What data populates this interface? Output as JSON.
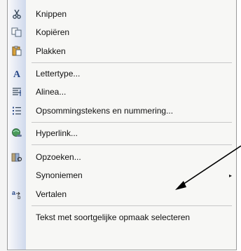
{
  "menu": {
    "items": [
      {
        "label": "Knippen",
        "icon": "scissors-icon"
      },
      {
        "label": "Kopiëren",
        "icon": "copy-icon"
      },
      {
        "label": "Plakken",
        "icon": "paste-icon"
      },
      {
        "label": "Lettertype...",
        "icon": "font-icon"
      },
      {
        "label": "Alinea...",
        "icon": "paragraph-icon"
      },
      {
        "label": "Opsommingstekens en nummering...",
        "icon": "bullets-icon"
      },
      {
        "label": "Hyperlink...",
        "icon": "hyperlink-icon"
      },
      {
        "label": "Opzoeken...",
        "icon": "lookup-icon"
      },
      {
        "label": "Synoniemen",
        "icon": ""
      },
      {
        "label": "Vertalen",
        "icon": "translate-icon"
      },
      {
        "label": "Tekst met soortgelijke opmaak selecteren",
        "icon": ""
      }
    ],
    "submenu_arrow": "▸"
  },
  "colors": {
    "menu_background": "#f7f7f5",
    "icon_column_gradient": [
      "#f9f9fb",
      "#cfd9ec"
    ],
    "pointer_arrow": "#000000"
  }
}
